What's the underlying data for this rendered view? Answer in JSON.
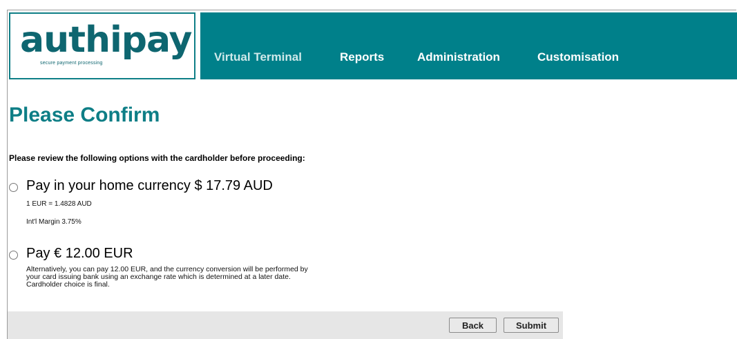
{
  "logo": {
    "text": "authipay",
    "tagline": "secure payment processing"
  },
  "nav": {
    "items": [
      {
        "label": "Virtual Terminal"
      },
      {
        "label": "Reports"
      },
      {
        "label": "Administration"
      },
      {
        "label": "Customisation"
      }
    ]
  },
  "page": {
    "title": "Please Confirm",
    "review_text": "Please review the following options with the cardholder before proceeding:"
  },
  "options": [
    {
      "label": "Pay in your home currency $ 17.79 AUD",
      "rate": "1 EUR = 1.4828 AUD",
      "margin": "Int'l Margin 3.75%"
    },
    {
      "label": "Pay € 12.00 EUR",
      "description": "Alternatively, you can pay 12.00 EUR, and the currency conversion will be performed by your card issuing bank using an exchange rate which is determined at a later date. Cardholder choice is final."
    }
  ],
  "buttons": {
    "back": "Back",
    "submit": "Submit"
  },
  "colors": {
    "brand": "#00808a",
    "title": "#0e7e86"
  }
}
